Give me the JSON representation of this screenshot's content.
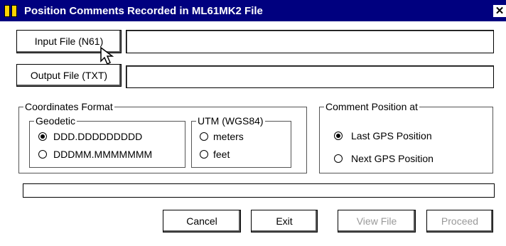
{
  "window": {
    "title": "Position Comments Recorded in ML61MK2 File",
    "close_glyph": "✕"
  },
  "buttons": {
    "input_file": "Input File (N61)",
    "output_file": "Output File (TXT)",
    "cancel": "Cancel",
    "exit": "Exit",
    "view_file": "View File",
    "proceed": "Proceed"
  },
  "inputs": {
    "input_path": "",
    "output_path": ""
  },
  "coordinates_format": {
    "label": "Coordinates Format",
    "geodetic": {
      "label": "Geodetic",
      "options": [
        "DDD.DDDDDDDDD",
        "DDDMM.MMMMMMM"
      ],
      "selected": "DDD.DDDDDDDDD"
    },
    "utm": {
      "label": "UTM (WGS84)",
      "options": [
        "meters",
        "feet"
      ],
      "selected": null
    }
  },
  "comment_position": {
    "label": "Comment Position at",
    "options": [
      "Last GPS Position",
      "Next GPS Position"
    ],
    "selected": "Last GPS Position"
  },
  "progress": {
    "value": 0
  },
  "icons": {
    "app": "app-icon",
    "close": "close-icon",
    "cursor": "mouse-pointer-icon"
  }
}
